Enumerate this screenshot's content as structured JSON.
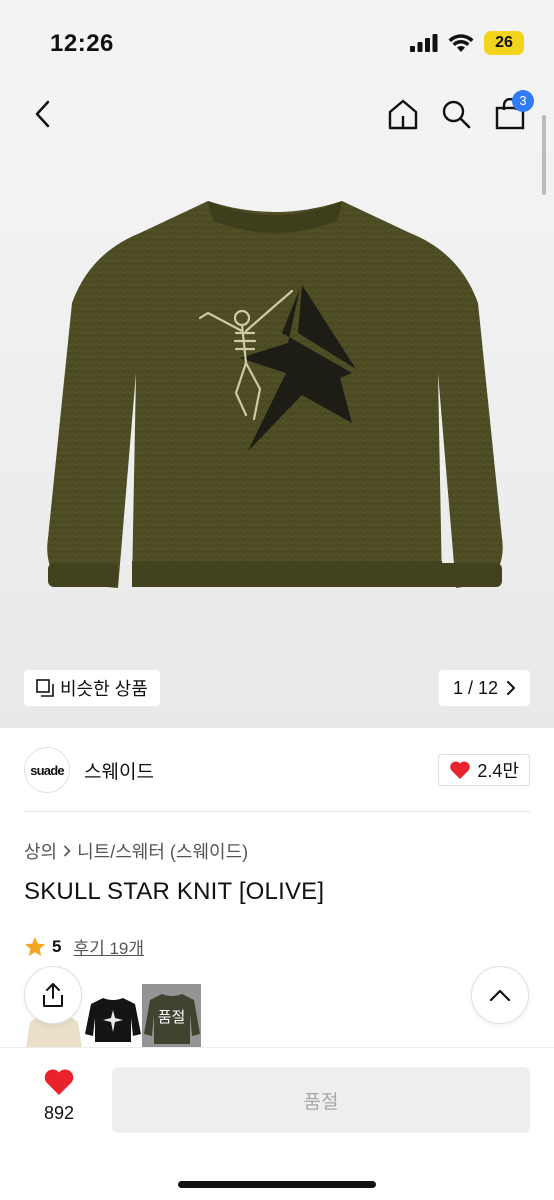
{
  "status": {
    "time": "12:26",
    "battery": "26"
  },
  "nav": {
    "cart_count": "3"
  },
  "hero": {
    "similar_label": "비슷한 상품",
    "pager": "1 / 12"
  },
  "brand": {
    "logo_text": "suade",
    "name": "스웨이드",
    "likes": "2.4만"
  },
  "breadcrumb": {
    "level1": "상의",
    "level2": "니트/스웨터 (스웨이드)"
  },
  "product": {
    "title": "SKULL STAR KNIT [OLIVE]",
    "rating": "5",
    "reviews": "후기 19개"
  },
  "thumbnails": [
    {
      "color": "beige"
    },
    {
      "color": "black"
    },
    {
      "color": "olive",
      "overlay": "품절"
    }
  ],
  "bottom": {
    "wish_count": "892",
    "buy_label": "품절"
  },
  "colors": {
    "olive": "#4b4a22",
    "heart": "#e8232b",
    "badge": "#2f7cf6",
    "star": "#f5a623"
  }
}
